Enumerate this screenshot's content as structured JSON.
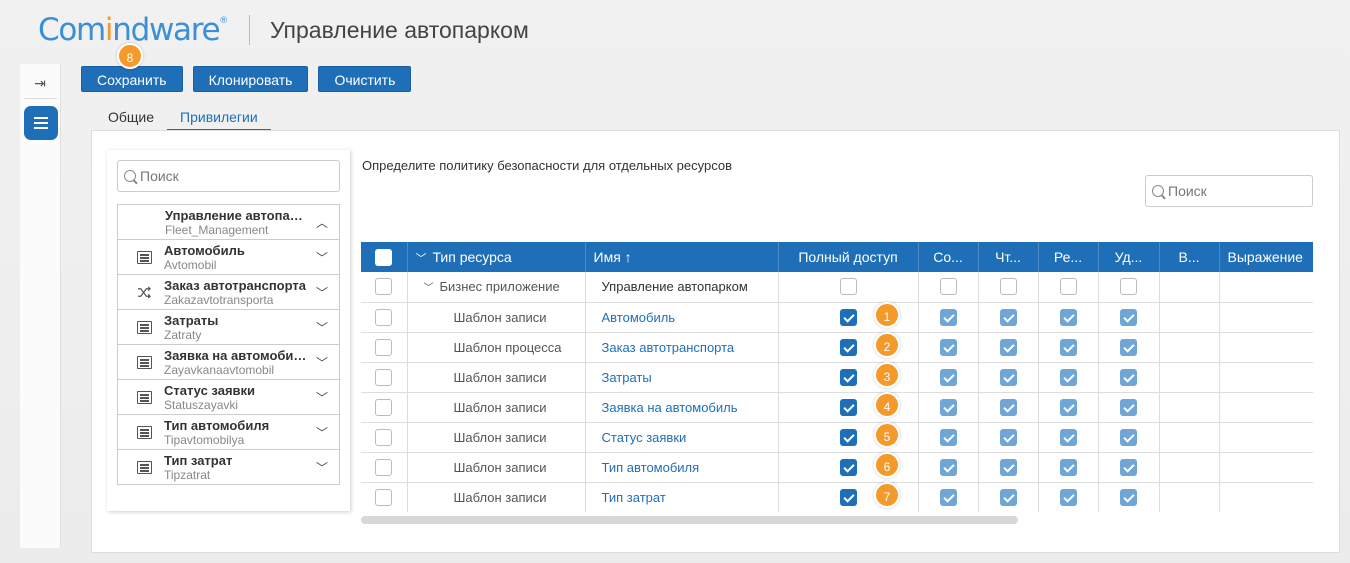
{
  "header": {
    "logo_part1": "Com",
    "logo_part2": "i",
    "logo_part3": "ndware",
    "logo_reg": "®",
    "app_title": "Управление автопарком"
  },
  "toolbar": {
    "save_label": "Сохранить",
    "clone_label": "Клонировать",
    "clear_label": "Очистить",
    "save_marker": "8"
  },
  "tabs": [
    {
      "label": "Общие",
      "active": false
    },
    {
      "label": "Привилегии",
      "active": true
    }
  ],
  "tree": {
    "search_placeholder": "Поиск",
    "items": [
      {
        "name": "Управление автопарком",
        "system": "Fleet_Management",
        "icon": "none",
        "expanded": true
      },
      {
        "name": "Автомобиль",
        "system": "Avtomobil",
        "icon": "list-icon"
      },
      {
        "name": "Заказ автотранспорта",
        "system": "Zakazavtotransporta",
        "icon": "shuffle-icon"
      },
      {
        "name": "Затраты",
        "system": "Zatraty",
        "icon": "list-icon"
      },
      {
        "name": "Заявка на автомобиль",
        "system": "Zayavkanaavtomobil",
        "icon": "list-icon"
      },
      {
        "name": "Статус заявки",
        "system": "Statuszayavki",
        "icon": "list-icon"
      },
      {
        "name": "Тип автомобиля",
        "system": "Tipavtomobilya",
        "icon": "list-icon"
      },
      {
        "name": "Тип затрат",
        "system": "Tipzatrat",
        "icon": "list-icon"
      }
    ]
  },
  "main": {
    "description": "Определите политику безопасности для отдельных ресурсов",
    "search_placeholder": "Поиск"
  },
  "grid": {
    "columns": [
      "Тип ресурса",
      "Имя ↑",
      "Полный доступ",
      "Со...",
      "Чт...",
      "Ре...",
      "Уд...",
      "В...",
      "Выражение"
    ],
    "rows": [
      {
        "type": "Бизнес приложение",
        "name": "Управление автопарком",
        "full": false,
        "create": false,
        "read": false,
        "edit": false,
        "delete": false,
        "marker": ""
      },
      {
        "type": "Шаблон записи",
        "name": "Автомобиль",
        "full": true,
        "create": true,
        "read": true,
        "edit": true,
        "delete": true,
        "marker": "1"
      },
      {
        "type": "Шаблон процесса",
        "name": "Заказ автотранспорта",
        "full": true,
        "create": true,
        "read": true,
        "edit": true,
        "delete": true,
        "marker": "2"
      },
      {
        "type": "Шаблон записи",
        "name": "Затраты",
        "full": true,
        "create": true,
        "read": true,
        "edit": true,
        "delete": true,
        "marker": "3"
      },
      {
        "type": "Шаблон записи",
        "name": "Заявка на автомобиль",
        "full": true,
        "create": true,
        "read": true,
        "edit": true,
        "delete": true,
        "marker": "4"
      },
      {
        "type": "Шаблон записи",
        "name": "Статус заявки",
        "full": true,
        "create": true,
        "read": true,
        "edit": true,
        "delete": true,
        "marker": "5"
      },
      {
        "type": "Шаблон записи",
        "name": "Тип автомобиля",
        "full": true,
        "create": true,
        "read": true,
        "edit": true,
        "delete": true,
        "marker": "6"
      },
      {
        "type": "Шаблон записи",
        "name": "Тип затрат",
        "full": true,
        "create": true,
        "read": true,
        "edit": true,
        "delete": true,
        "marker": "7"
      }
    ]
  },
  "colors": {
    "accent": "#1e6fb8",
    "marker": "#f39a2b"
  }
}
